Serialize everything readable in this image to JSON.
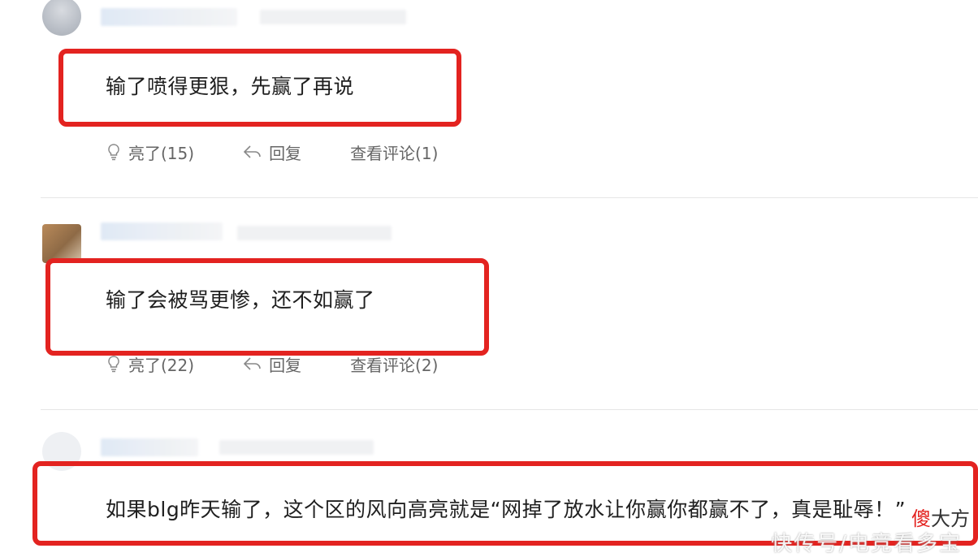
{
  "comments": [
    {
      "text": "输了喷得更狠，先赢了再说",
      "like_label": "亮了(15)",
      "reply_label": "回复",
      "view_replies_label": "查看评论(1)"
    },
    {
      "text": "输了会被骂更惨，还不如赢了",
      "like_label": "亮了(22)",
      "reply_label": "回复",
      "view_replies_label": "查看评论(2)"
    },
    {
      "text": "如果blg昨天输了，这个区的风向高亮就是“网掉了放水让你赢你都赢不了，真是耻辱！”"
    }
  ],
  "watermark": {
    "highlight": "傻",
    "rest": "大方",
    "source": "快传号/电竞看多宝"
  },
  "colors": {
    "highlight_box": "#e32320",
    "action_text": "#666666"
  },
  "icons": {
    "like": "lightbulb-icon",
    "reply": "reply-arrow-icon"
  }
}
